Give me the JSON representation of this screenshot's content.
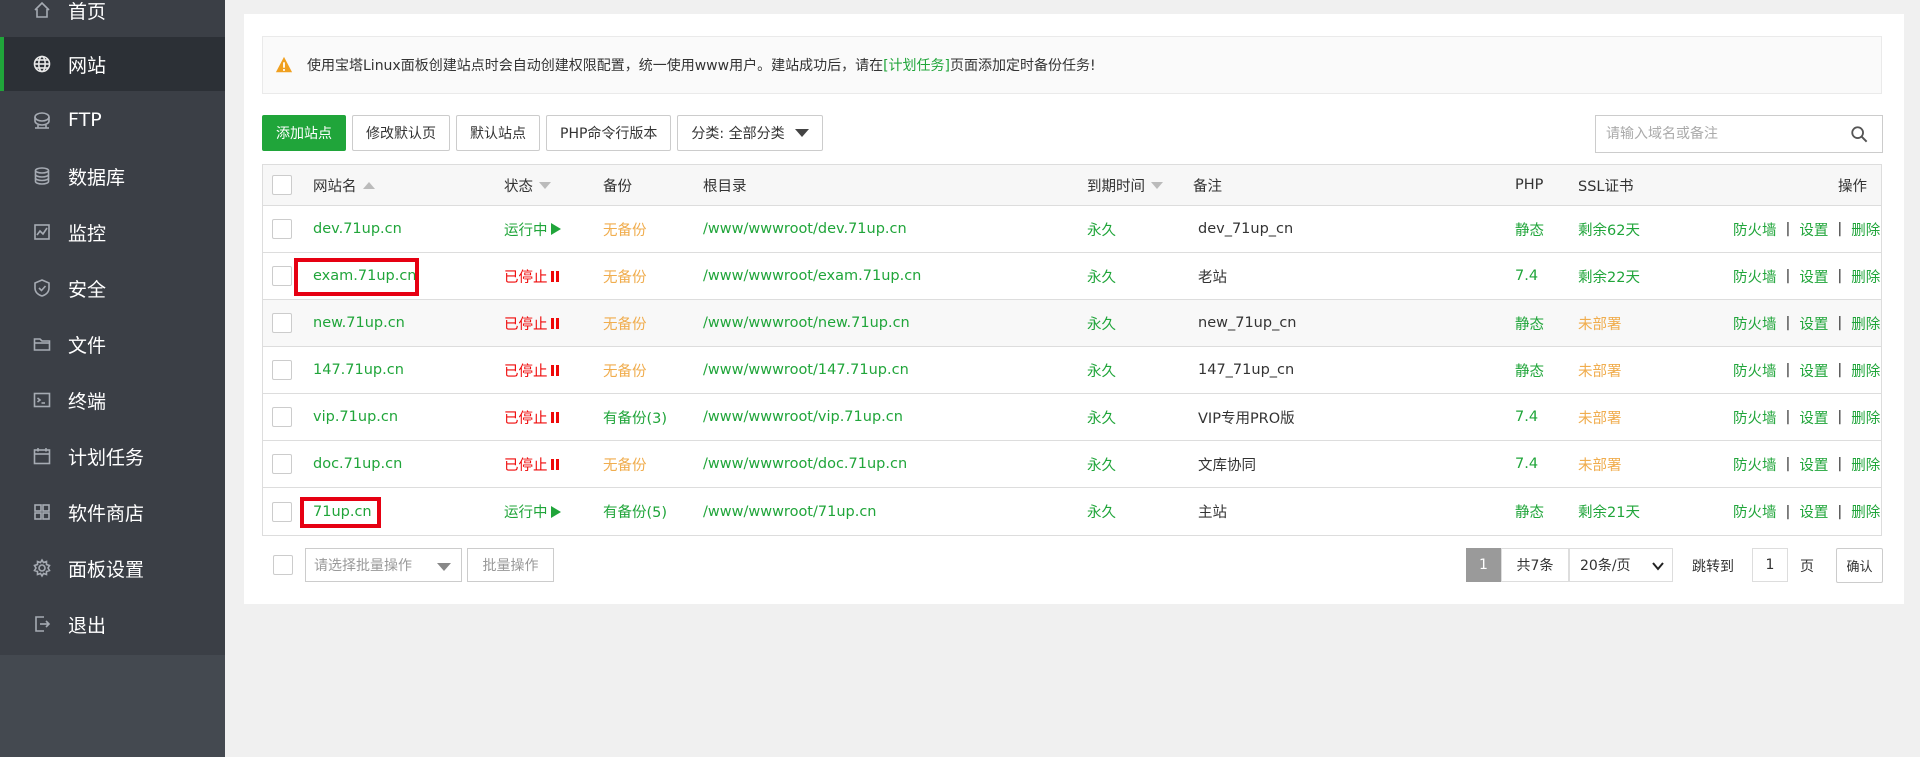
{
  "sidebar": {
    "items": [
      {
        "label": "首页",
        "icon": "home-icon"
      },
      {
        "label": "网站",
        "icon": "globe-icon"
      },
      {
        "label": "FTP",
        "icon": "ftp-icon"
      },
      {
        "label": "数据库",
        "icon": "database-icon"
      },
      {
        "label": "监控",
        "icon": "monitor-icon"
      },
      {
        "label": "安全",
        "icon": "shield-icon"
      },
      {
        "label": "文件",
        "icon": "folder-icon"
      },
      {
        "label": "终端",
        "icon": "terminal-icon"
      },
      {
        "label": "计划任务",
        "icon": "calendar-icon"
      },
      {
        "label": "软件商店",
        "icon": "apps-icon"
      },
      {
        "label": "面板设置",
        "icon": "gear-icon"
      },
      {
        "label": "退出",
        "icon": "logout-icon"
      }
    ],
    "active": "网站"
  },
  "notice": {
    "text_before": "使用宝塔Linux面板创建站点时会自动创建权限配置，统一使用www用户。建站成功后，请在",
    "link": "[计划任务]",
    "text_after": "页面添加定时备份任务!"
  },
  "toolbar": {
    "add_site": "添加站点",
    "modify_default_page": "修改默认页",
    "default_site": "默认站点",
    "php_cli_version": "PHP命令行版本",
    "category": "分类: 全部分类"
  },
  "search": {
    "placeholder": "请输入域名或备注"
  },
  "table": {
    "headers": {
      "name": "网站名",
      "status": "状态",
      "backup": "备份",
      "root": "根目录",
      "expire": "到期时间",
      "remark": "备注",
      "php": "PHP",
      "ssl": "SSL证书",
      "ops": "操作"
    },
    "rows": [
      {
        "name": "dev.71up.cn",
        "status": "运行中",
        "running": true,
        "backup": "无备份",
        "has_backup": false,
        "root": "/www/wwwroot/dev.71up.cn",
        "expire": "永久",
        "remark": "dev_71up_cn",
        "php": "静态",
        "ssl": "剩余62天",
        "ssl_ok": true
      },
      {
        "name": "exam.71up.cn",
        "status": "已停止",
        "running": false,
        "backup": "无备份",
        "has_backup": false,
        "root": "/www/wwwroot/exam.71up.cn",
        "expire": "永久",
        "remark": "老站",
        "php": "7.4",
        "ssl": "剩余22天",
        "ssl_ok": true,
        "highlight": true
      },
      {
        "name": "new.71up.cn",
        "status": "已停止",
        "running": false,
        "backup": "无备份",
        "has_backup": false,
        "root": "/www/wwwroot/new.71up.cn",
        "expire": "永久",
        "remark": "new_71up_cn",
        "php": "静态",
        "ssl": "未部署",
        "ssl_ok": false
      },
      {
        "name": "147.71up.cn",
        "status": "已停止",
        "running": false,
        "backup": "无备份",
        "has_backup": false,
        "root": "/www/wwwroot/147.71up.cn",
        "expire": "永久",
        "remark": "147_71up_cn",
        "php": "静态",
        "ssl": "未部署",
        "ssl_ok": false
      },
      {
        "name": "vip.71up.cn",
        "status": "已停止",
        "running": false,
        "backup": "有备份(3)",
        "has_backup": true,
        "root": "/www/wwwroot/vip.71up.cn",
        "expire": "永久",
        "remark": "VIP专用PRO版",
        "php": "7.4",
        "ssl": "未部署",
        "ssl_ok": false
      },
      {
        "name": "doc.71up.cn",
        "status": "已停止",
        "running": false,
        "backup": "无备份",
        "has_backup": false,
        "root": "/www/wwwroot/doc.71up.cn",
        "expire": "永久",
        "remark": "文库协同",
        "php": "7.4",
        "ssl": "未部署",
        "ssl_ok": false
      },
      {
        "name": "71up.cn",
        "status": "运行中",
        "running": true,
        "backup": "有备份(5)",
        "has_backup": true,
        "root": "/www/wwwroot/71up.cn",
        "expire": "永久",
        "remark": "主站",
        "php": "静态",
        "ssl": "剩余21天",
        "ssl_ok": true,
        "highlight": true
      }
    ],
    "ops": {
      "firewall": "防火墙",
      "settings": "设置",
      "delete": "删除",
      "sep": "|"
    }
  },
  "footer": {
    "batch_placeholder": "请选择批量操作",
    "batch_button": "批量操作",
    "page_current": "1",
    "total": "共7条",
    "page_size": "20条/页",
    "jump_label": "跳转到",
    "jump_value": "1",
    "page_unit": "页",
    "confirm": "确认"
  },
  "colors": {
    "accent": "#20a53a",
    "stopped": "#ef0808",
    "warning": "#f0ad4e",
    "sidebar": "#3b3f46",
    "highlight_box": "#e60012"
  }
}
